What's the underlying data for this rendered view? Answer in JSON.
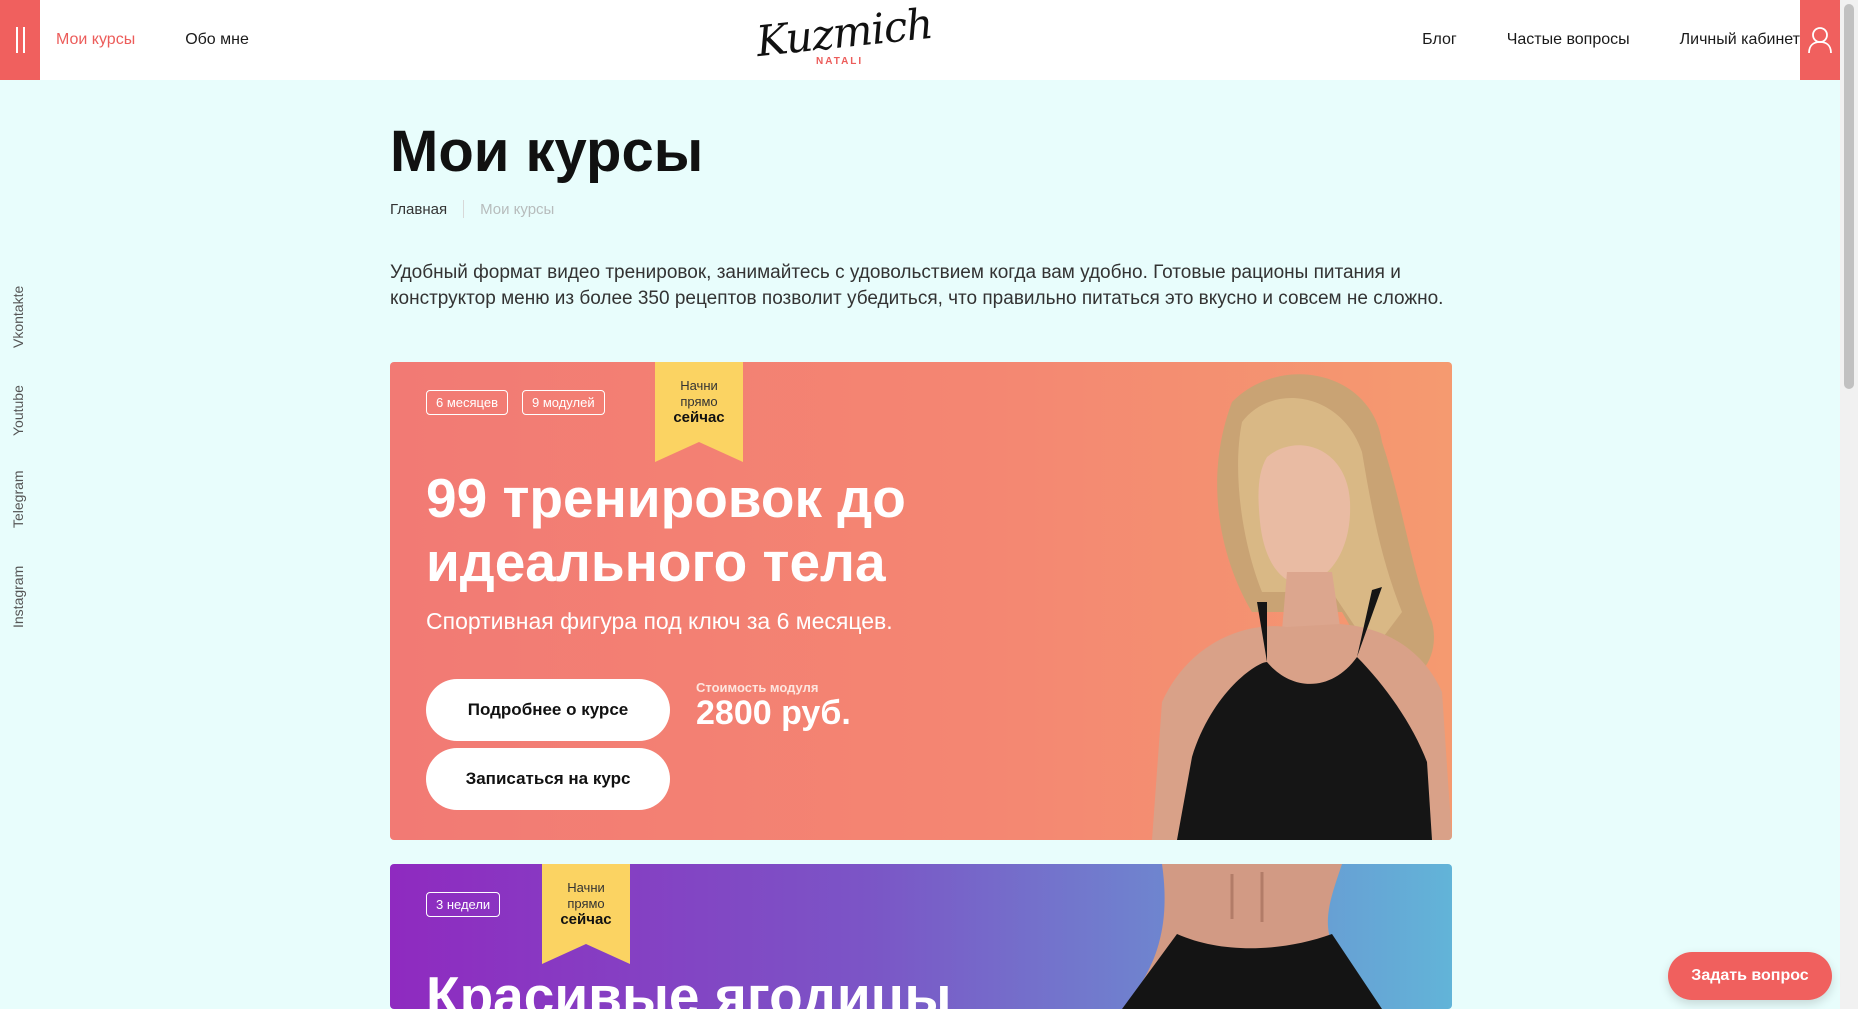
{
  "header": {
    "nav_left": [
      "Мои курсы",
      "Обо мне"
    ],
    "logo": {
      "script": "Kuzmich",
      "sub": "NATALI"
    },
    "nav_right": [
      "Блог",
      "Частые вопросы",
      "Личный кабинет"
    ]
  },
  "socials": [
    "Vkontakte",
    "Youtube",
    "Telegram",
    "Instagram"
  ],
  "page": {
    "title": "Мои курсы",
    "breadcrumb": {
      "home": "Главная",
      "current": "Мои курсы"
    },
    "intro": "Удобный формат видео тренировок, занимайтесь с удовольствием когда вам удобно. Готовые рационы питания и конструктор меню из более 350 рецептов позволит убедиться, что правильно питаться это вкусно и совсем не сложно."
  },
  "courses": [
    {
      "tags": [
        "6 месяцев",
        "9 модулей"
      ],
      "ribbon": {
        "line1": "Начни",
        "line2": "прямо",
        "line3": "сейчас"
      },
      "title": "99 тренировок до идеального тела",
      "subtitle": "Спортивная фигура под ключ за 6 месяцев.",
      "details_button": "Подробнее о курсе",
      "enroll_button": "Записаться на курс",
      "price_label": "Стоимость модуля",
      "price": "2800 руб."
    },
    {
      "tags": [
        "3 недели"
      ],
      "ribbon": {
        "line1": "Начни",
        "line2": "прямо",
        "line3": "сейчас"
      },
      "title": "Красивые ягодицы"
    }
  ],
  "ask_button": "Задать вопрос",
  "colors": {
    "accent": "#f0605e",
    "ribbon": "#fbd362",
    "background": "#e8fdfc"
  }
}
